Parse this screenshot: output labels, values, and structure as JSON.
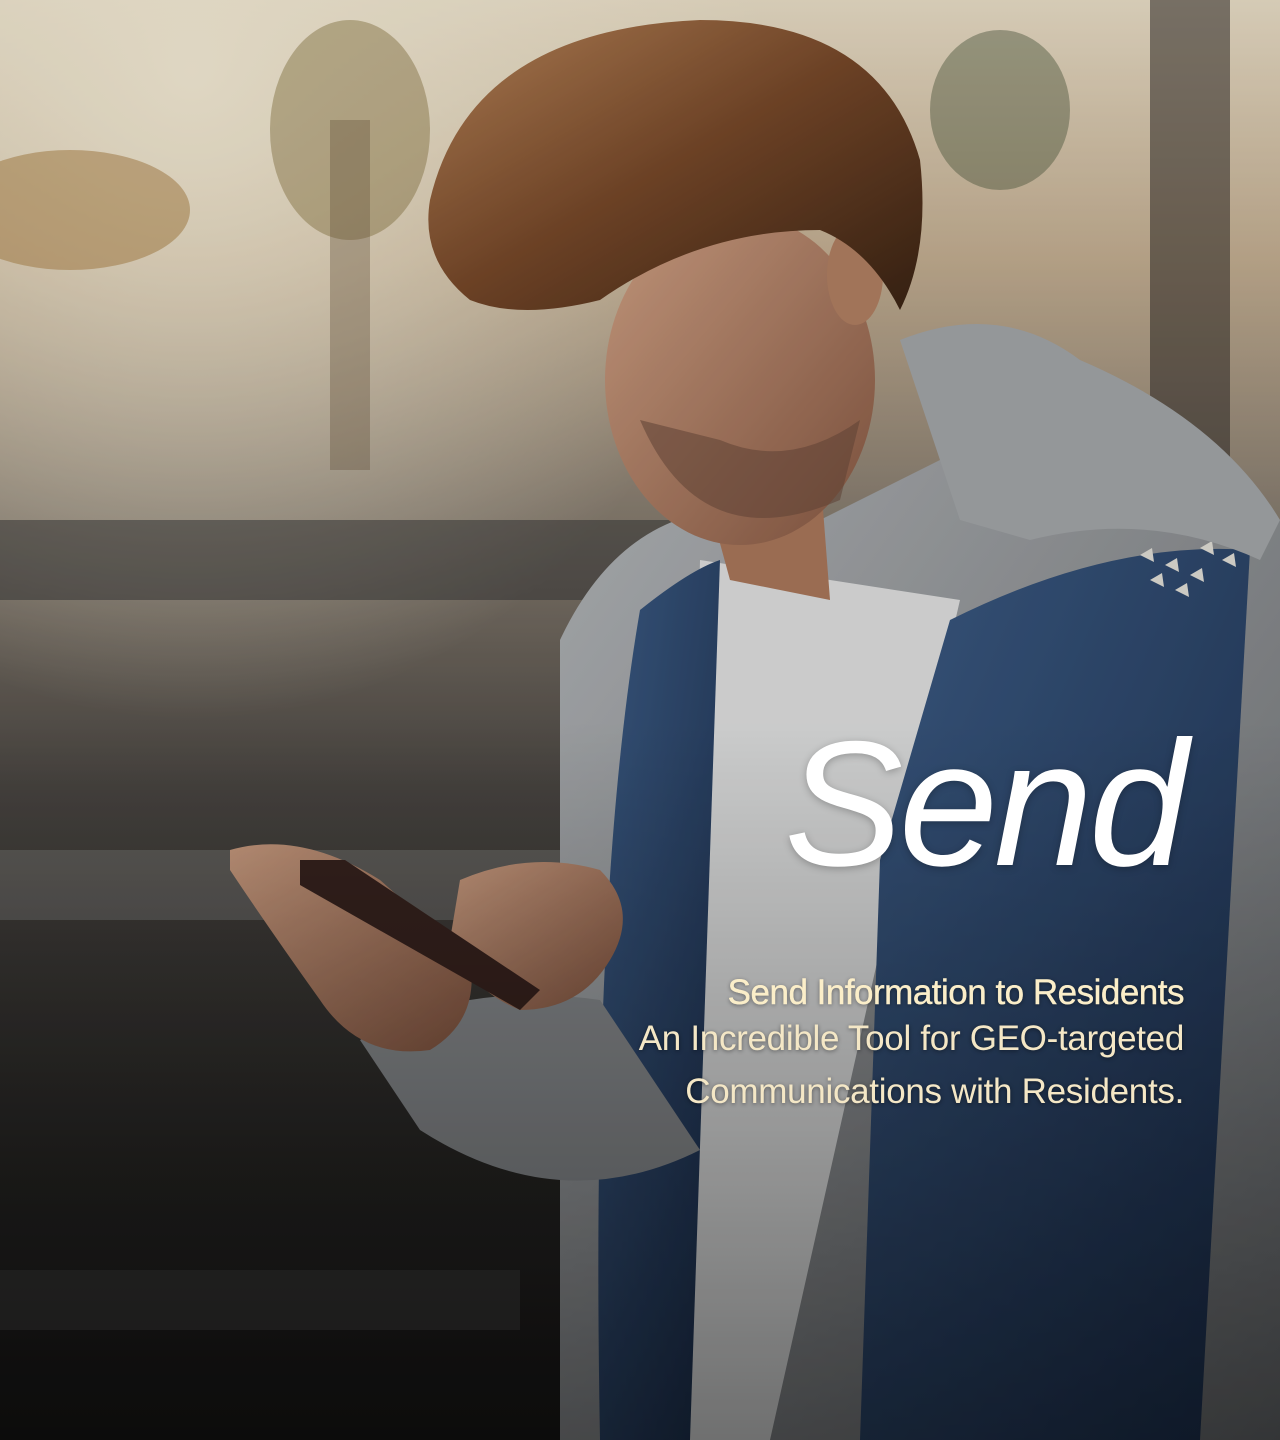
{
  "hero": {
    "headline": "Send",
    "subheadline": "Send Information to Residents",
    "body_lines": [
      "An Incredible Tool for GEO-targeted",
      "Communications with Residents."
    ],
    "background_image": "man-using-smartphone-photo"
  },
  "colors": {
    "headline": "#ffffff",
    "subheadline": "#fbeec9",
    "body": "#f4e7c6"
  }
}
